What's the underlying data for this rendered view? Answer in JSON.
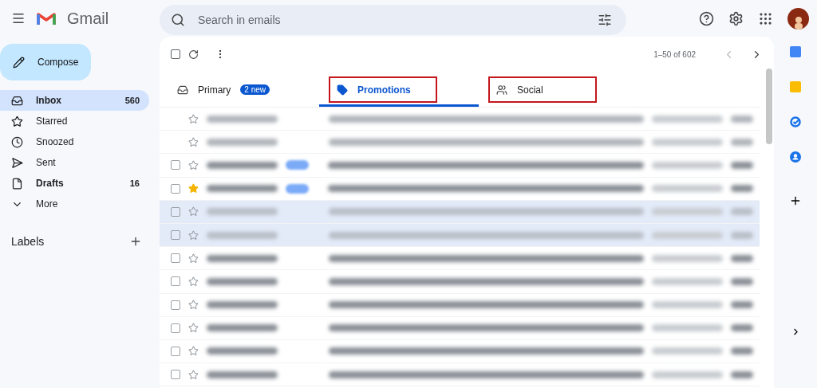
{
  "header": {
    "app_name": "Gmail",
    "search": {
      "placeholder": "Search in emails"
    }
  },
  "compose": {
    "label": "Compose"
  },
  "sidebar": {
    "items": [
      {
        "label": "Inbox",
        "count": "560",
        "selected": true,
        "bold": true
      },
      {
        "label": "Starred",
        "selected": false,
        "bold": false
      },
      {
        "label": "Snoozed",
        "selected": false,
        "bold": false
      },
      {
        "label": "Sent",
        "selected": false,
        "bold": false
      },
      {
        "label": "Drafts",
        "count": "16",
        "selected": false,
        "bold": true
      },
      {
        "label": "More",
        "selected": false,
        "bold": false
      }
    ],
    "labels_heading": "Labels"
  },
  "toolbar": {
    "select_all_checked": false,
    "range": "1–50 of 602"
  },
  "tabs": [
    {
      "label": "Primary",
      "badge": "2 new",
      "selected": false,
      "highlighted": false
    },
    {
      "label": "Promotions",
      "selected": true,
      "highlighted": true
    },
    {
      "label": "Social",
      "selected": false,
      "highlighted": true
    }
  ],
  "emails": [
    {
      "kind": "ad",
      "starred": false,
      "read": false,
      "tagged": false
    },
    {
      "kind": "ad",
      "starred": false,
      "read": false,
      "tagged": false
    },
    {
      "kind": "mail",
      "starred": false,
      "read": false,
      "tagged": true
    },
    {
      "kind": "mail",
      "starred": true,
      "read": false,
      "tagged": true
    },
    {
      "kind": "mail",
      "starred": false,
      "read": true,
      "tagged": false
    },
    {
      "kind": "mail",
      "starred": false,
      "read": true,
      "tagged": false
    },
    {
      "kind": "mail",
      "starred": false,
      "read": false,
      "tagged": false
    },
    {
      "kind": "mail",
      "starred": false,
      "read": false,
      "tagged": false
    },
    {
      "kind": "mail",
      "starred": false,
      "read": false,
      "tagged": false
    },
    {
      "kind": "mail",
      "starred": false,
      "read": false,
      "tagged": false
    },
    {
      "kind": "mail",
      "starred": false,
      "read": false,
      "tagged": false
    },
    {
      "kind": "mail",
      "starred": false,
      "read": false,
      "tagged": false
    }
  ]
}
